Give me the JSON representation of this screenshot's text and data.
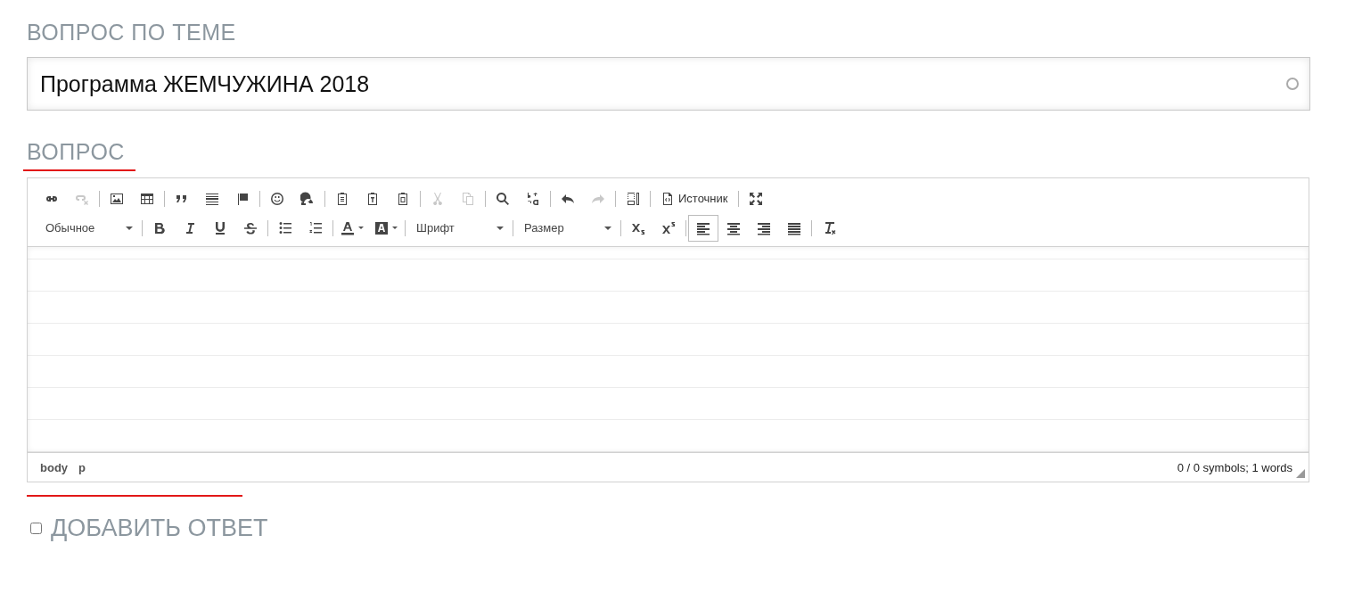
{
  "topic": {
    "label": "ВОПРОС ПО ТЕМЕ",
    "value": "Программа ЖЕМЧУЖИНА 2018"
  },
  "question": {
    "label": "ВОПРОС"
  },
  "toolbar": {
    "rows": [
      [
        {
          "kind": "button",
          "disabled": false
        },
        {
          "kind": "button",
          "disabled": true
        },
        {
          "kind": "separator"
        },
        {
          "kind": "button",
          "disabled": false
        },
        {
          "kind": "button",
          "disabled": false
        },
        {
          "kind": "separator"
        },
        {
          "kind": "button",
          "disabled": false
        },
        {
          "kind": "button",
          "disabled": false
        },
        {
          "kind": "button",
          "disabled": false
        },
        {
          "kind": "separator"
        },
        {
          "kind": "button",
          "disabled": false
        },
        {
          "kind": "button",
          "disabled": false
        },
        {
          "kind": "separator"
        },
        {
          "kind": "button",
          "disabled": false
        },
        {
          "kind": "button",
          "disabled": false
        },
        {
          "kind": "button",
          "disabled": false
        },
        {
          "kind": "separator"
        },
        {
          "kind": "button",
          "disabled": true
        },
        {
          "kind": "button",
          "disabled": true
        },
        {
          "kind": "separator"
        },
        {
          "kind": "button",
          "disabled": false
        },
        {
          "kind": "button",
          "disabled": false
        },
        {
          "kind": "separator"
        },
        {
          "kind": "button",
          "disabled": false
        },
        {
          "kind": "button",
          "disabled": true
        },
        {
          "kind": "separator"
        },
        {
          "kind": "button",
          "disabled": false
        },
        {
          "kind": "separator"
        },
        {
          "kind": "labeled",
          "label": "Источник",
          "disabled": false
        },
        {
          "kind": "separator"
        },
        {
          "kind": "button",
          "disabled": false
        }
      ],
      [
        {
          "kind": "combo",
          "label": "Обычное"
        },
        {
          "kind": "separator"
        },
        {
          "kind": "button",
          "disabled": false
        },
        {
          "kind": "button",
          "disabled": false
        },
        {
          "kind": "button",
          "disabled": false
        },
        {
          "kind": "button",
          "disabled": false
        },
        {
          "kind": "separator"
        },
        {
          "kind": "button",
          "disabled": false
        },
        {
          "kind": "button",
          "disabled": false
        },
        {
          "kind": "separator"
        },
        {
          "kind": "color",
          "disabled": false
        },
        {
          "kind": "color",
          "disabled": false
        },
        {
          "kind": "separator"
        },
        {
          "kind": "combo",
          "label": "Шрифт"
        },
        {
          "kind": "separator"
        },
        {
          "kind": "combo",
          "label": "Размер"
        },
        {
          "kind": "separator"
        },
        {
          "kind": "button",
          "disabled": false
        },
        {
          "kind": "button",
          "disabled": false
        },
        {
          "kind": "separator"
        },
        {
          "kind": "button",
          "disabled": false,
          "selected": true
        },
        {
          "kind": "button",
          "disabled": false,
          "selected": false
        },
        {
          "kind": "button",
          "disabled": false,
          "selected": false
        },
        {
          "kind": "button",
          "disabled": false,
          "selected": false
        },
        {
          "kind": "separator"
        },
        {
          "kind": "button",
          "disabled": false
        }
      ]
    ]
  },
  "status_bar": {
    "path": [
      "body",
      "p"
    ],
    "counter": "0 / 0 symbols; 1 words"
  },
  "add_answer": {
    "label": "ДОБАВИТЬ ОТВЕТ",
    "checked": false
  }
}
